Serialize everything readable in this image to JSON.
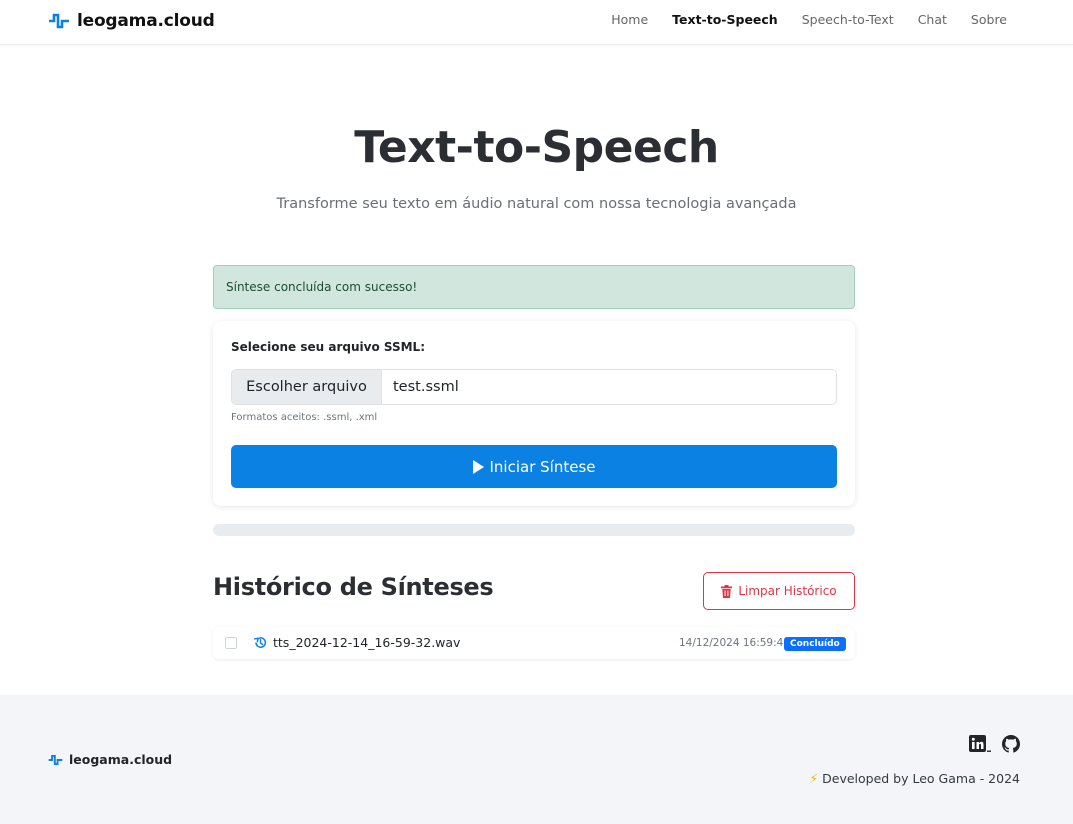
{
  "nav": {
    "brand": "leogama.cloud",
    "links": [
      "Home",
      "Text-to-Speech",
      "Speech-to-Text",
      "Chat",
      "Sobre"
    ],
    "active_index": 1
  },
  "hero": {
    "title": "Text-to-Speech",
    "subtitle": "Transforme seu texto em áudio natural com nossa tecnologia avançada"
  },
  "alert": {
    "message": "Síntese concluída com sucesso!"
  },
  "form": {
    "label": "Selecione seu arquivo SSML:",
    "file_button": "Escolher arquivo",
    "file_name": "test.ssml",
    "help": "Formatos aceitos: .ssml, .xml",
    "submit_label": "Iniciar Síntese"
  },
  "progress": {
    "value": 0
  },
  "history": {
    "title": "Histórico de Sínteses",
    "clear_label": "Limpar Histórico",
    "items": [
      {
        "file": "tts_2024-12-14_16-59-32.wav",
        "date": "14/12/2024 16:59:41",
        "status": "Concluído"
      }
    ]
  },
  "footer": {
    "brand": "leogama.cloud",
    "developed": "Developed by Leo Gama - 2024"
  },
  "colors": {
    "primary": "#0b82e3",
    "danger": "#dc3545",
    "success_bg": "#d1e7dd",
    "badge": "#0d6efd"
  }
}
